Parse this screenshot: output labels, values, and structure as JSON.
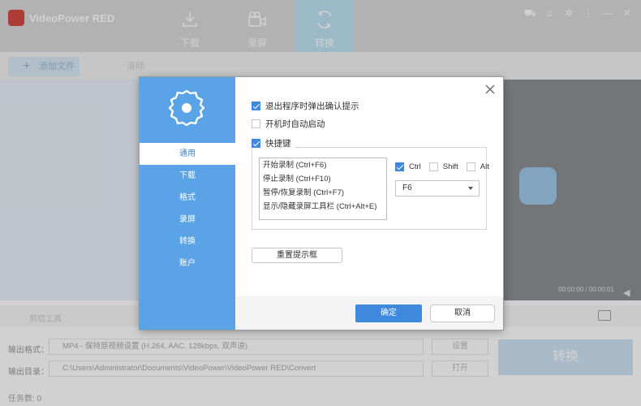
{
  "app": {
    "title": "VideoPower RED",
    "nav_tabs": [
      {
        "label": "下载",
        "icon": "download-icon"
      },
      {
        "label": "录屏",
        "icon": "camera-icon"
      },
      {
        "label": "转换",
        "icon": "convert-icon"
      }
    ],
    "window_controls": [
      "cart-icon",
      "user-icon",
      "settings-icon",
      "menu-icon",
      "minimize-icon",
      "close-icon"
    ],
    "toolbar": {
      "add_file": "添加文件",
      "clear": "清除"
    },
    "preview": {
      "timecode": "00:00:00 / 00:00:01"
    },
    "cut_tools": {
      "label": "剪切工具"
    },
    "output": {
      "format_label": "输出格式：",
      "format_value": "MP4 - 保持原视频设置 (H.264, AAC, 128kbps, 双声道)",
      "settings_button": "设置",
      "dir_label": "输出目录：",
      "dir_value": "C:\\Users\\Administrator\\Documents\\VideoPower\\VideoPower RED\\Convert",
      "open_button": "打开",
      "convert_button": "转换"
    },
    "task_count": "任务数: 0"
  },
  "dialog": {
    "sidebar": {
      "items": [
        {
          "label": "通用",
          "active": true
        },
        {
          "label": "下载"
        },
        {
          "label": "格式"
        },
        {
          "label": "录屏"
        },
        {
          "label": "转换"
        },
        {
          "label": "账户"
        }
      ]
    },
    "options": {
      "confirm_on_exit": {
        "label": "退出程序时弹出确认提示",
        "checked": true
      },
      "auto_start": {
        "label": "开机时自动启动",
        "checked": false
      }
    },
    "hotkeys": {
      "title": "快捷键",
      "enabled": true,
      "items": [
        "开始录制 (Ctrl+F6)",
        "停止录制 (Ctrl+F10)",
        "暂停/恢复录制 (Ctrl+F7)",
        "显示/隐藏录屏工具栏 (Ctrl+Alt+E)"
      ],
      "modifiers": [
        {
          "label": "Ctrl",
          "checked": true
        },
        {
          "label": "Shift",
          "checked": false
        },
        {
          "label": "Alt",
          "checked": false
        }
      ],
      "key": "F6"
    },
    "reset_button": "重置提示框",
    "ok_button": "确定",
    "cancel_button": "取消"
  },
  "colors": {
    "accent": "#3e88de",
    "sidebar": "#5aa3e6",
    "brand_red": "#d24a43"
  }
}
